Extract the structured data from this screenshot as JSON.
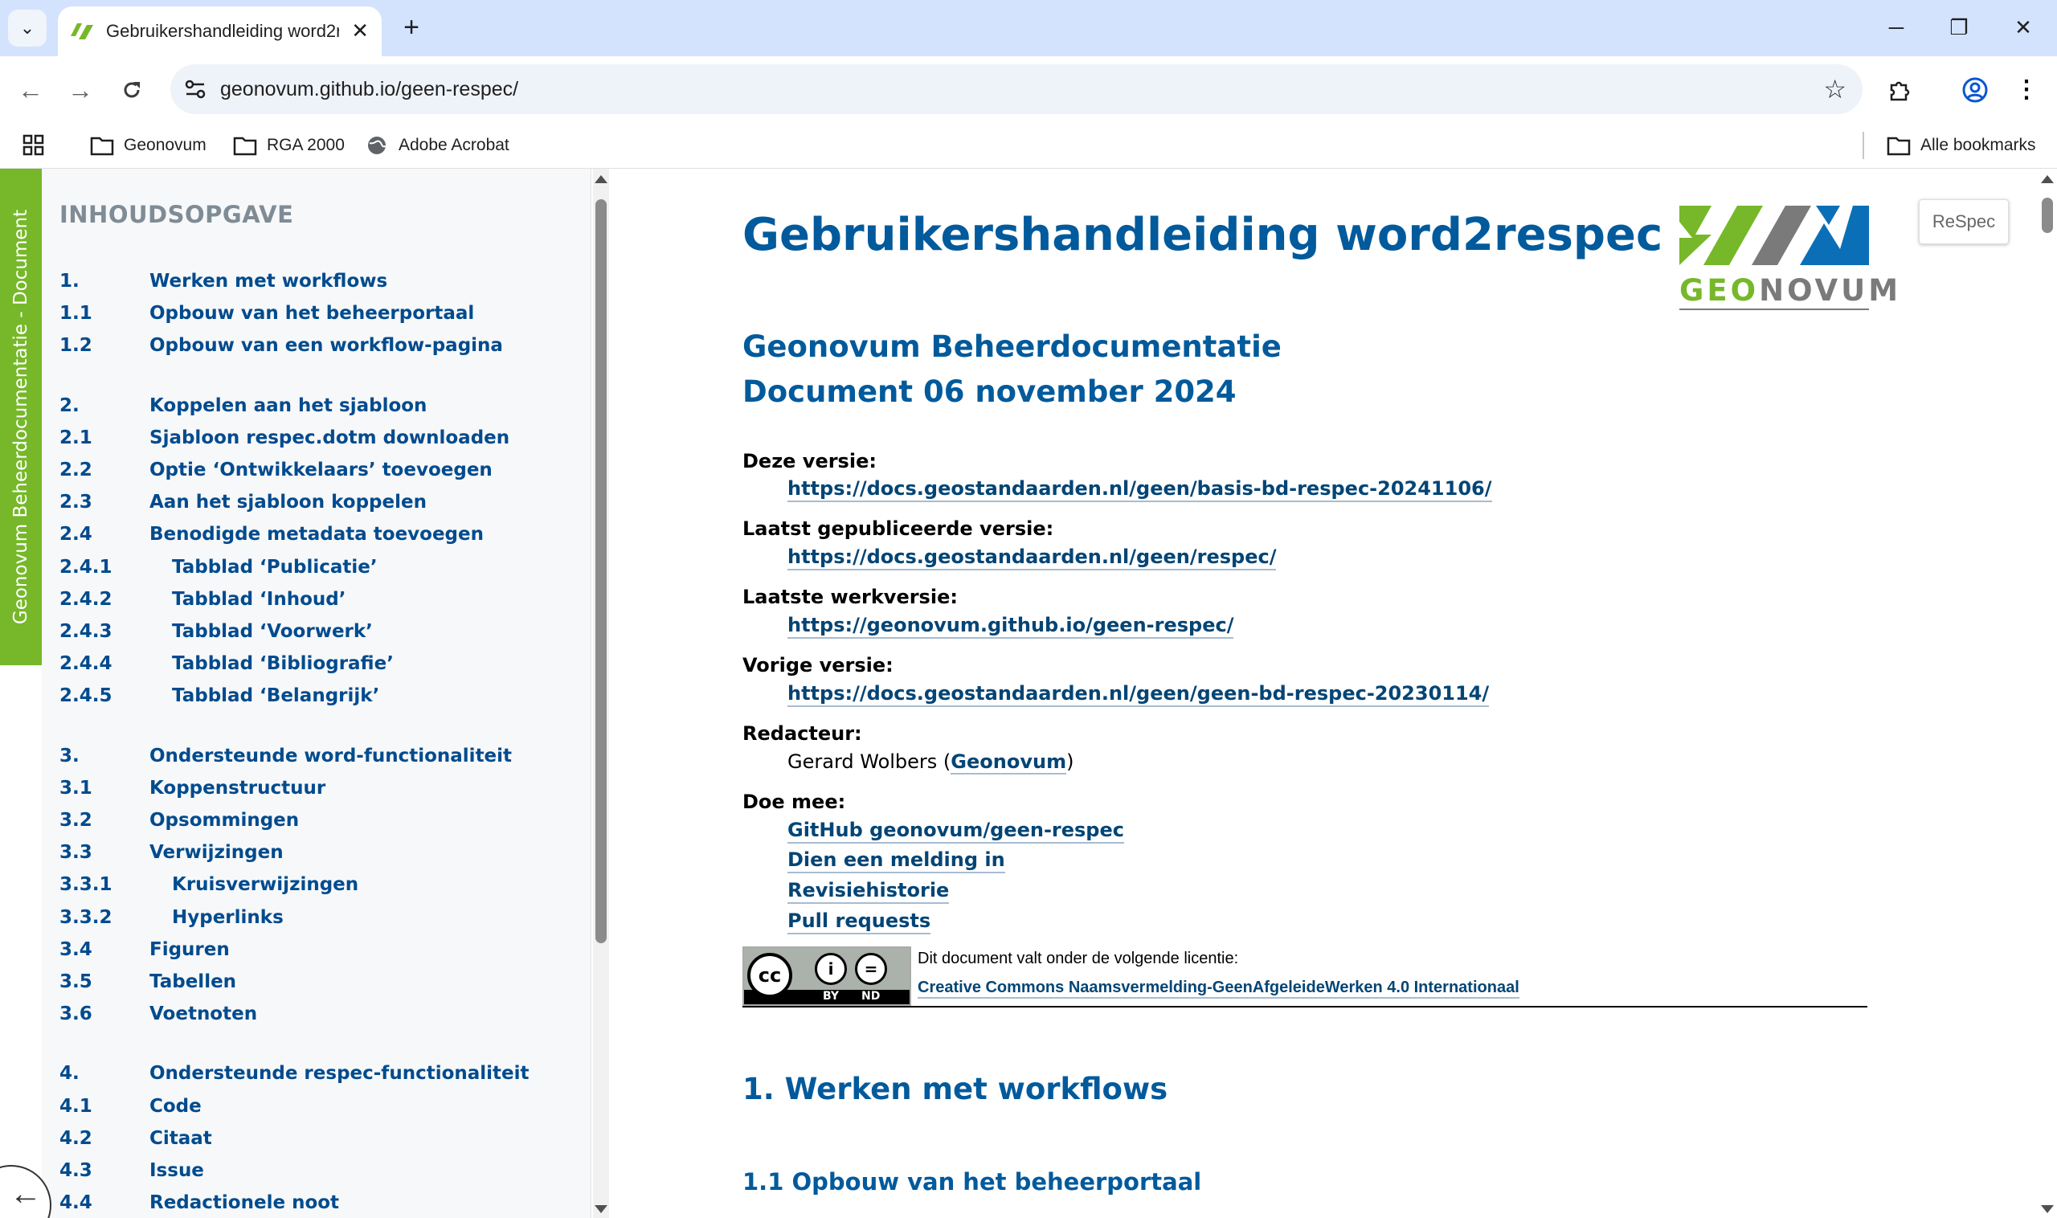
{
  "browser": {
    "tab_title": "Gebruikershandleiding word2re",
    "url": "geonovum.github.io/geen-respec/",
    "window_controls": {
      "minimize": "─",
      "restore": "❐",
      "close": "✕"
    }
  },
  "bookmarks": {
    "items": [
      {
        "label": "Geonovum",
        "icon": "folder-icon"
      },
      {
        "label": "RGA 2000",
        "icon": "folder-icon"
      },
      {
        "label": "Adobe Acrobat",
        "icon": "globe-icon"
      }
    ],
    "all_label": "Alle bookmarks"
  },
  "toc": {
    "side_tab": "Geonovum Beheerdocumentatie - Document",
    "heading": "INHOUDSOPGAVE",
    "items": [
      {
        "num": "1.",
        "title": "Werken met workflows"
      },
      {
        "num": "1.1",
        "title": "Opbouw van het beheerportaal"
      },
      {
        "num": "1.2",
        "title": "Opbouw van een workflow-pagina"
      },
      {
        "num": "2.",
        "title": "Koppelen aan het sjabloon"
      },
      {
        "num": "2.1",
        "title": "Sjabloon respec.dotm downloaden"
      },
      {
        "num": "2.2",
        "title": "Optie ‘Ontwikkelaars’ toevoegen"
      },
      {
        "num": "2.3",
        "title": "Aan het sjabloon koppelen"
      },
      {
        "num": "2.4",
        "title": "Benodigde metadata toevoegen"
      },
      {
        "num": "2.4.1",
        "title": "Tabblad ‘Publicatie’"
      },
      {
        "num": "2.4.2",
        "title": "Tabblad ‘Inhoud’"
      },
      {
        "num": "2.4.3",
        "title": "Tabblad ‘Voorwerk’"
      },
      {
        "num": "2.4.4",
        "title": "Tabblad ‘Bibliografie’"
      },
      {
        "num": "2.4.5",
        "title": "Tabblad ‘Belangrijk’"
      },
      {
        "num": "3.",
        "title": "Ondersteunde word-functionaliteit"
      },
      {
        "num": "3.1",
        "title": "Koppenstructuur"
      },
      {
        "num": "3.2",
        "title": "Opsommingen"
      },
      {
        "num": "3.3",
        "title": "Verwijzingen"
      },
      {
        "num": "3.3.1",
        "title": "Kruisverwijzingen"
      },
      {
        "num": "3.3.2",
        "title": "Hyperlinks"
      },
      {
        "num": "3.4",
        "title": "Figuren"
      },
      {
        "num": "3.5",
        "title": "Tabellen"
      },
      {
        "num": "3.6",
        "title": "Voetnoten"
      },
      {
        "num": "4.",
        "title": "Ondersteunde respec-functionaliteit"
      },
      {
        "num": "4.1",
        "title": "Code"
      },
      {
        "num": "4.2",
        "title": "Citaat"
      },
      {
        "num": "4.3",
        "title": "Issue"
      },
      {
        "num": "4.4",
        "title": "Redactionele noot"
      }
    ]
  },
  "doc": {
    "title": "Gebruikershandleiding word2respec",
    "logo_text_green": "GEO",
    "logo_text_grey": "NOVUM",
    "subtitle_1": "Geonovum Beheerdocumentatie",
    "subtitle_2": "Document 06 november 2024",
    "this_version_label": "Deze versie:",
    "this_version_url": "https://docs.geostandaarden.nl/geen/basis-bd-respec-20241106/",
    "latest_published_label": "Laatst gepubliceerde versie:",
    "latest_published_url": "https://docs.geostandaarden.nl/geen/respec/",
    "latest_draft_label": "Laatste werkversie:",
    "latest_draft_url": "https://geonovum.github.io/geen-respec/",
    "previous_label": "Vorige versie:",
    "previous_url": "https://docs.geostandaarden.nl/geen/geen-bd-respec-20230114/",
    "editor_label": "Redacteur:",
    "editor_name": "Gerard Wolbers (",
    "editor_org": "Geonovum",
    "editor_close": ")",
    "participate_label": "Doe mee:",
    "participate_links": [
      "GitHub geonovum/geen-respec",
      "Dien een melding in",
      "Revisiehistorie",
      "Pull requests"
    ],
    "license_intro": "Dit document valt onder de volgende licentie:",
    "license_link": "Creative Commons Naamsvermelding-GeenAfgeleideWerken 4.0 Internationaal",
    "cc_by": "BY",
    "cc_nd": "ND",
    "h2": "1. Werken met workflows",
    "h3": "1.1 Opbouw van het beheerportaal"
  },
  "respec_button": "ReSpec",
  "colors": {
    "accent_green": "#76b82a",
    "heading_blue": "#005a9c",
    "toc_blue": "#004b8e"
  }
}
